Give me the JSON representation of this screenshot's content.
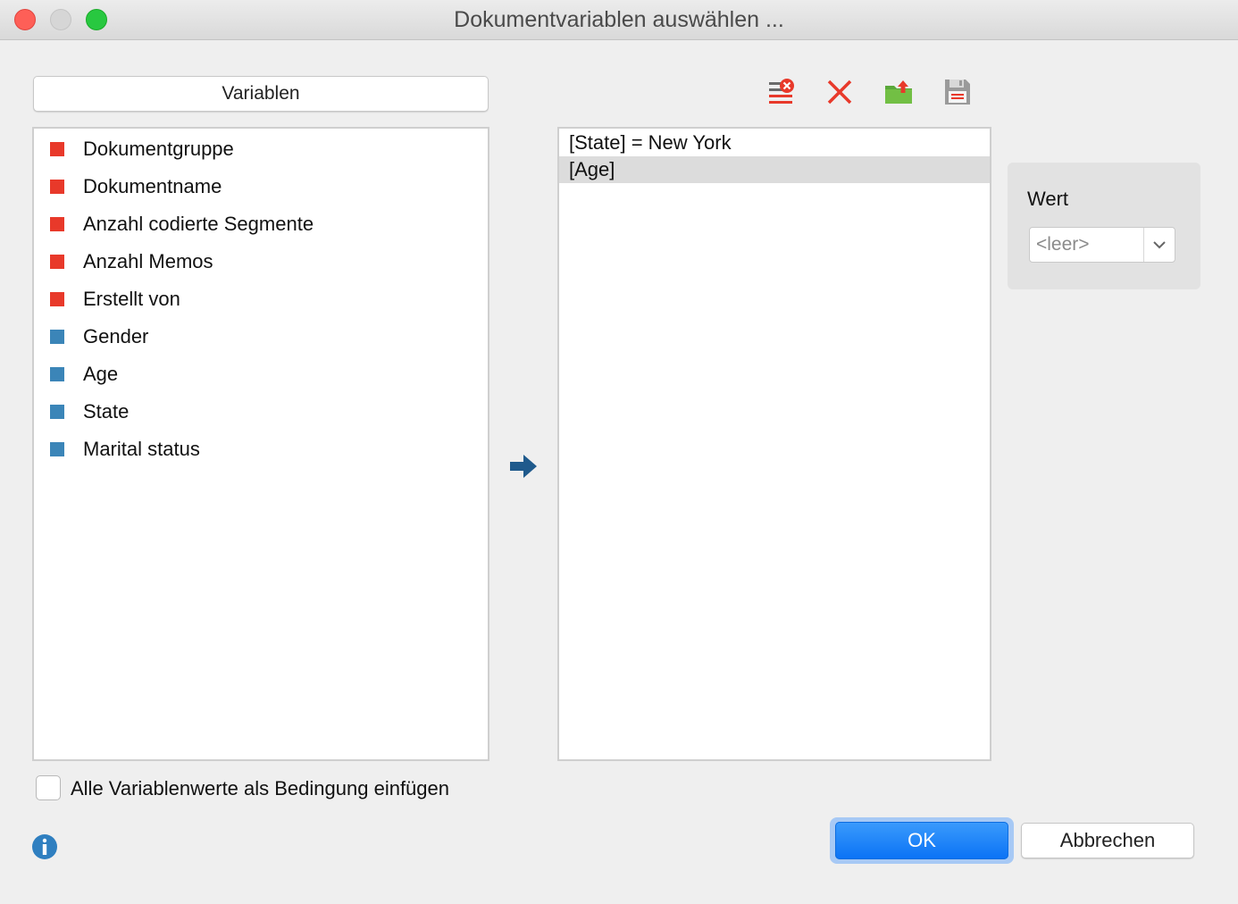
{
  "window": {
    "title": "Dokumentvariablen auswählen ..."
  },
  "variables": {
    "header_label": "Variablen",
    "items": [
      {
        "label": "Dokumentgruppe",
        "color": "#e8392a"
      },
      {
        "label": "Dokumentname",
        "color": "#e8392a"
      },
      {
        "label": "Anzahl codierte Segmente",
        "color": "#e8392a"
      },
      {
        "label": "Anzahl Memos",
        "color": "#e8392a"
      },
      {
        "label": "Erstellt von",
        "color": "#e8392a"
      },
      {
        "label": "Gender",
        "color": "#3b85b8"
      },
      {
        "label": "Age",
        "color": "#3b85b8"
      },
      {
        "label": "State",
        "color": "#3b85b8"
      },
      {
        "label": "Marital status",
        "color": "#3b85b8"
      }
    ]
  },
  "toolbar": {
    "icons": [
      "clear-list-icon",
      "delete-icon",
      "open-folder-icon",
      "save-icon"
    ]
  },
  "conditions": {
    "items": [
      {
        "label": "[State] = New York",
        "selected": false
      },
      {
        "label": "[Age]",
        "selected": true
      }
    ]
  },
  "wert": {
    "label": "Wert",
    "select_value": "<leer>"
  },
  "options": {
    "insert_all_label": "Alle Variablenwerte als Bedingung einfügen"
  },
  "buttons": {
    "ok_label": "OK",
    "cancel_label": "Abbrechen"
  },
  "colors": {
    "accent": "#0a72f5",
    "system_var": "#e8392a",
    "user_var": "#3b85b8"
  }
}
